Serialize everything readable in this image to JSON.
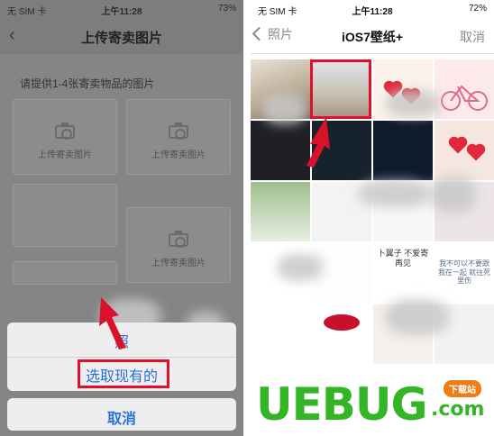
{
  "left_phone": {
    "status": {
      "carrier": "无 SIM 卡",
      "time": "上午11:28",
      "battery": "73%"
    },
    "nav": {
      "back_icon": "chevron-left-icon",
      "title": "上传寄卖图片"
    },
    "prompt": "请提供1-4张寄卖物品的图片",
    "upload_slots": [
      {
        "label": "上传寄卖图片"
      },
      {
        "label": "上传寄卖图片"
      },
      {
        "label": "上传寄卖图片"
      }
    ],
    "action_sheet": {
      "take_photo_label": "照",
      "choose_existing_label": "选取现有的",
      "cancel_label": "取消"
    },
    "highlight_color": "#e0102c"
  },
  "right_phone": {
    "status": {
      "carrier": "无 SIM 卡",
      "time": "上午11:28",
      "battery": "72%"
    },
    "nav": {
      "back_label": "照片",
      "title": "iOS7壁纸+",
      "cancel_label": "取消"
    },
    "thumbnails": [
      {
        "text": ""
      },
      {
        "text": ""
      },
      {
        "text": ""
      },
      {
        "text": ""
      },
      {
        "text": ""
      },
      {
        "text": ""
      },
      {
        "text": ""
      },
      {
        "text": ""
      },
      {
        "text": ""
      },
      {
        "text": ""
      },
      {
        "text": ""
      },
      {
        "text": ""
      },
      {
        "text": ""
      },
      {
        "text": ""
      },
      {
        "text": "卜翼子 不爱寄 再见"
      },
      {
        "text": "我不可以不要跟我在一起 就往死里伤"
      },
      {
        "text": ""
      },
      {
        "text": ""
      },
      {
        "text": ""
      },
      {
        "text": ""
      }
    ]
  },
  "watermark": {
    "logo": "UEBUG",
    "suffix": ".com",
    "badge": "下载站"
  }
}
